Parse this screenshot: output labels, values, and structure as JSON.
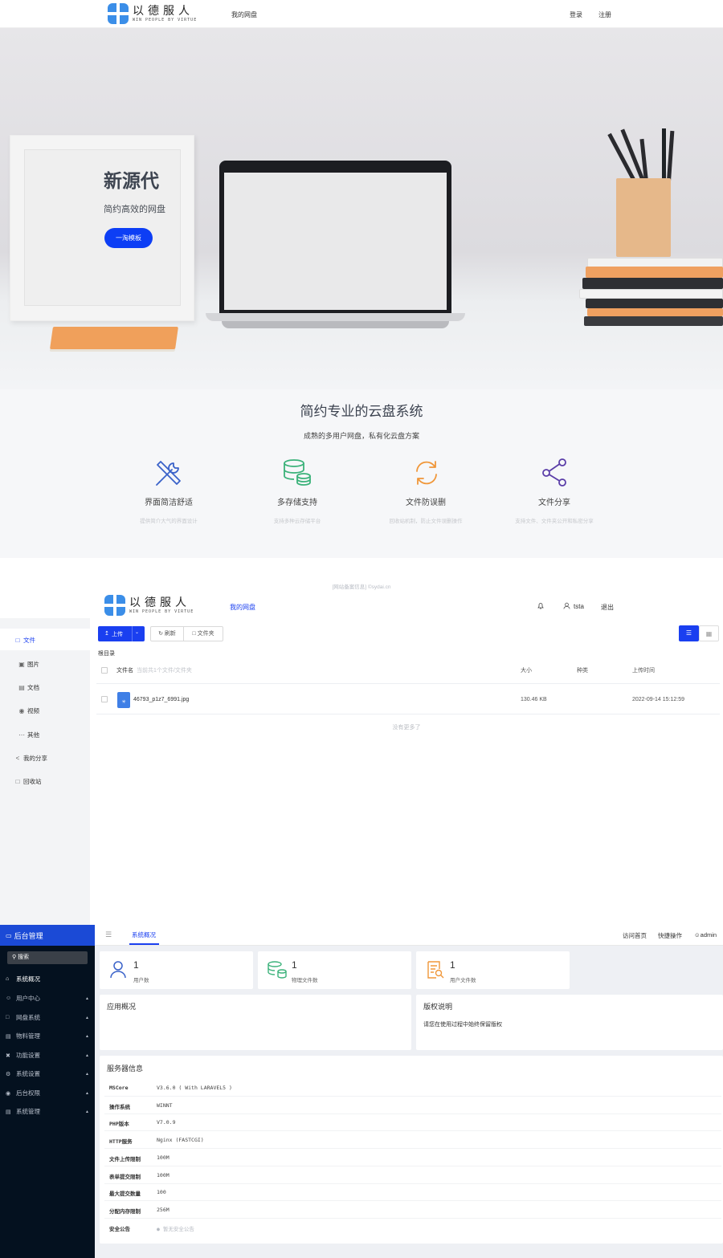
{
  "site": {
    "brand_cn": "以德服人",
    "brand_en": "WIN PEOPLE BY VIRTUE",
    "nav_mydisk": "我的网盘",
    "login": "登录",
    "register": "注册"
  },
  "hero": {
    "title": "新源代",
    "subtitle": "简约高效的网盘",
    "button": "一淘模板"
  },
  "features": {
    "title": "简约专业的云盘系统",
    "subtitle": "成熟的多用户网盘，私有化云盘方案",
    "items": [
      {
        "name": "界面简洁舒适",
        "desc": "提供简介大气的界面设计",
        "icon": "tools-icon",
        "color": "#3a62c9"
      },
      {
        "name": "多存储支持",
        "desc": "支持多种云存储平台",
        "icon": "database-icon",
        "color": "#3bb27a"
      },
      {
        "name": "文件防误删",
        "desc": "回收站机制，防止文件误删操作",
        "icon": "refresh-icon",
        "color": "#f0973a"
      },
      {
        "name": "文件分享",
        "desc": "支持文件、文件夹公开和私密分享",
        "icon": "share-icon",
        "color": "#5a3da8"
      }
    ],
    "icp": "[网站备案信息] ©sydai.cn"
  },
  "filemanager": {
    "nav_mydisk": "我的网盘",
    "username": "tsta",
    "logout": "退出",
    "sidebar": [
      {
        "label": "文件",
        "icon": "file-icon"
      },
      {
        "label": "图片",
        "icon": "image-icon"
      },
      {
        "label": "文档",
        "icon": "document-icon"
      },
      {
        "label": "视频",
        "icon": "video-icon"
      },
      {
        "label": "其他",
        "icon": "more-icon"
      },
      {
        "label": "我的分享",
        "icon": "share-icon"
      },
      {
        "label": "回收站",
        "icon": "trash-icon"
      }
    ],
    "toolbar": {
      "upload": "上传",
      "refresh": "刷新",
      "folder": "文件夹"
    },
    "breadcrumb": "根目录",
    "columns": {
      "name": "文件名",
      "hint": "当前共1个文件/文件夹",
      "size": "大小",
      "type": "种类",
      "time": "上传时间"
    },
    "files": [
      {
        "name": "46793_p1z7_6991.jpg",
        "size": "130.46 KB",
        "type": "",
        "time": "2022-09-14 15:12:59"
      }
    ],
    "no_more": "没有更多了"
  },
  "admin": {
    "brand": "后台管理",
    "search": "搜索",
    "menu": [
      {
        "label": "系统概况",
        "icon": "home-icon",
        "active": true
      },
      {
        "label": "用户中心",
        "icon": "user-icon"
      },
      {
        "label": "网盘系统",
        "icon": "folder-icon"
      },
      {
        "label": "物料管理",
        "icon": "box-icon"
      },
      {
        "label": "功能设置",
        "icon": "tools-icon"
      },
      {
        "label": "系统设置",
        "icon": "gear-icon"
      },
      {
        "label": "后台权限",
        "icon": "lock-icon"
      },
      {
        "label": "系统管理",
        "icon": "list-icon"
      }
    ],
    "tab": "系统概况",
    "top_links": {
      "visit": "访问首页",
      "quick": "快捷操作",
      "user": "admin"
    },
    "stats": [
      {
        "value": "1",
        "label": "用户数",
        "icon": "user-icon",
        "color": "#3a62c9"
      },
      {
        "value": "1",
        "label": "物理文件数",
        "icon": "database-icon",
        "color": "#3bb27a"
      },
      {
        "value": "1",
        "label": "用户文件数",
        "icon": "doc-search-icon",
        "color": "#f0973a"
      }
    ],
    "app_overview": "应用概况",
    "copyright_title": "版权说明",
    "copyright_text": "请您在使用过程中始终保留版权",
    "server_title": "服务器信息",
    "server": [
      {
        "k": "MSCore",
        "v": "V3.6.0 ( With LARAVEL5 )"
      },
      {
        "k": "操作系统",
        "v": "WINNT"
      },
      {
        "k": "PHP版本",
        "v": "V7.0.9"
      },
      {
        "k": "HTTP服务",
        "v": "Nginx (FASTCGI)"
      },
      {
        "k": "文件上传限制",
        "v": "100M"
      },
      {
        "k": "表单提交限制",
        "v": "100M"
      },
      {
        "k": "最大提交数量",
        "v": "100"
      },
      {
        "k": "分配内存限制",
        "v": "256M"
      },
      {
        "k": "安全公告",
        "v": "暂无安全公告"
      }
    ]
  }
}
